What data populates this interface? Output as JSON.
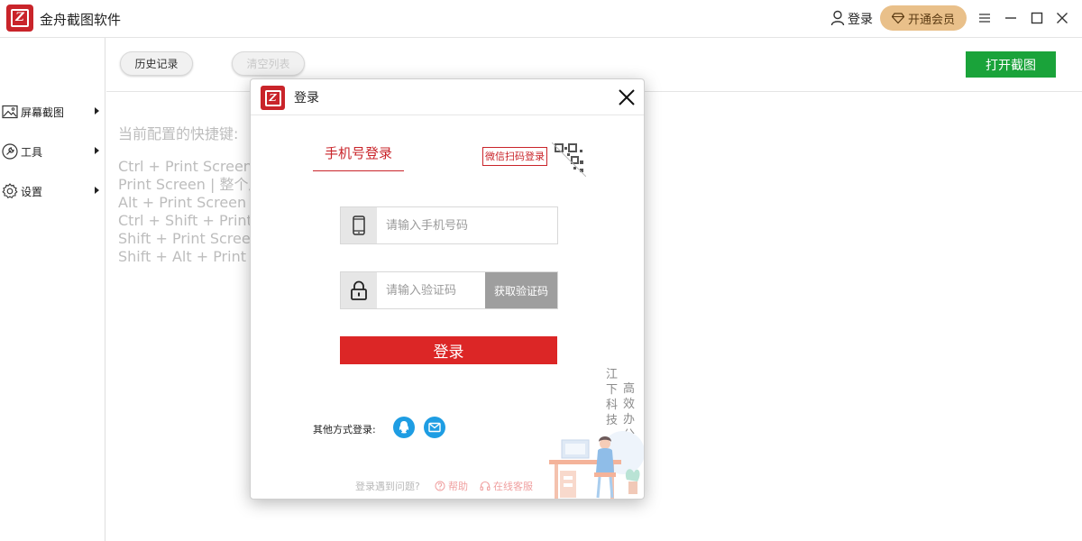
{
  "app": {
    "title": "金舟截图软件",
    "logo_glyph": "Z",
    "brand_color": "#c9242a"
  },
  "titlebar": {
    "login_label": "登录",
    "vip_label": "开通会员",
    "icons": [
      "user-icon",
      "diamond-icon",
      "menu-icon",
      "minimize-icon",
      "maximize-icon",
      "close-icon"
    ]
  },
  "sidebar": {
    "items": [
      {
        "label": "屏幕截图",
        "icon": "image-icon"
      },
      {
        "label": "工具",
        "icon": "wrench-icon"
      },
      {
        "label": "设置",
        "icon": "gear-icon"
      }
    ]
  },
  "toolbar": {
    "history_label": "历史记录",
    "clear_label": "清空列表",
    "open_capture_label": "打开截图",
    "accent_color": "#1aa33a"
  },
  "main": {
    "hotkey_caption": "当前配置的快捷键:",
    "hotkeys": [
      "Ctrl + Print Screen  |",
      "Print Screen  |  整个屏",
      "Alt + Print Screen  |",
      "Ctrl + Shift + Print Sc",
      "Shift + Print Screen",
      "Shift + Alt + Print Scr"
    ]
  },
  "dialog": {
    "title": "登录",
    "tab_phone": "手机号登录",
    "tab_wechat": "微信扫码登录",
    "phone_placeholder": "请输入手机号码",
    "phone_value": "",
    "code_placeholder": "请输入验证码",
    "code_value": "",
    "get_code_label": "获取验证码",
    "submit_label": "登录",
    "other_methods_label": "其他方式登录:",
    "social": [
      "qq-icon",
      "email-icon"
    ],
    "watermark_left": [
      "江",
      "下",
      "科",
      "技"
    ],
    "watermark_right": [
      "高",
      "效",
      "办",
      "公"
    ],
    "footer_question": "登录遇到问题?",
    "help_label": "帮助",
    "service_label": "在线客服",
    "submit_color": "#dc2626"
  }
}
